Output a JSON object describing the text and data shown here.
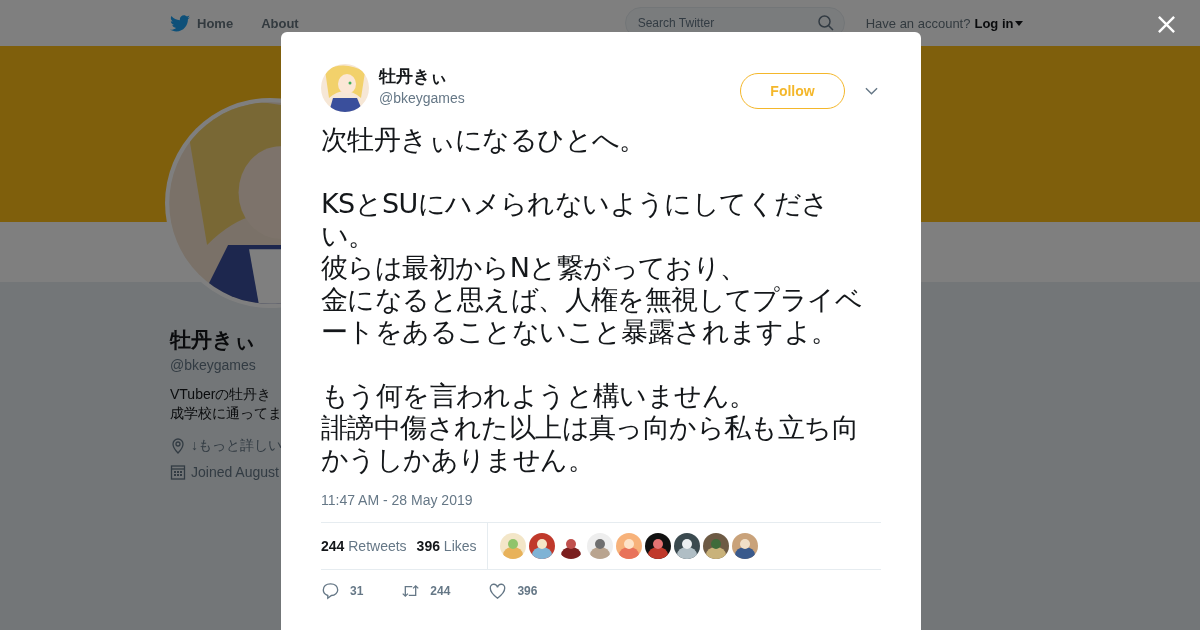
{
  "nav": {
    "home": "Home",
    "about": "About",
    "search_placeholder": "Search Twitter",
    "account_prompt": "Have an account?",
    "login": "Log in"
  },
  "profile": {
    "name": "牡丹きぃ",
    "handle": "@bkeygames",
    "bio_lines": [
      "VTuberの牡丹き",
      "成学校に通ってま"
    ],
    "location": "↓もっと詳しい",
    "joined": "Joined August"
  },
  "tweet": {
    "author": {
      "name": "牡丹きぃ",
      "handle": "@bkeygames"
    },
    "follow": "Follow",
    "paragraphs": [
      [
        "次牡丹きぃになるひとへ。"
      ],
      [
        "KSとSUにハメられないようにしてください。",
        "彼らは最初からNと繋がっており、",
        "金になると思えば、人権を無視してプライベートをあることないこと暴露されますよ。"
      ],
      [
        "もう何を言われようと構いません。",
        "誹謗中傷された以上は真っ向から私も立ち向かうしかありません。"
      ]
    ],
    "time": "11:47 AM - 28 May 2019",
    "retweets": {
      "count": "244",
      "label": "Retweets"
    },
    "likes": {
      "count": "396",
      "label": "Likes"
    },
    "liker_avatars": [
      {
        "kind": "picture"
      },
      {
        "kind": "picture"
      },
      {
        "kind": "picture"
      },
      {
        "kind": "picture"
      },
      {
        "kind": "picture"
      },
      {
        "kind": "picture"
      },
      {
        "kind": "picture"
      },
      {
        "kind": "picture"
      },
      {
        "kind": "picture"
      }
    ],
    "actions": [
      {
        "kind": "reply",
        "count": "31"
      },
      {
        "kind": "retweet",
        "count": "244"
      },
      {
        "kind": "like",
        "count": "396"
      }
    ]
  }
}
